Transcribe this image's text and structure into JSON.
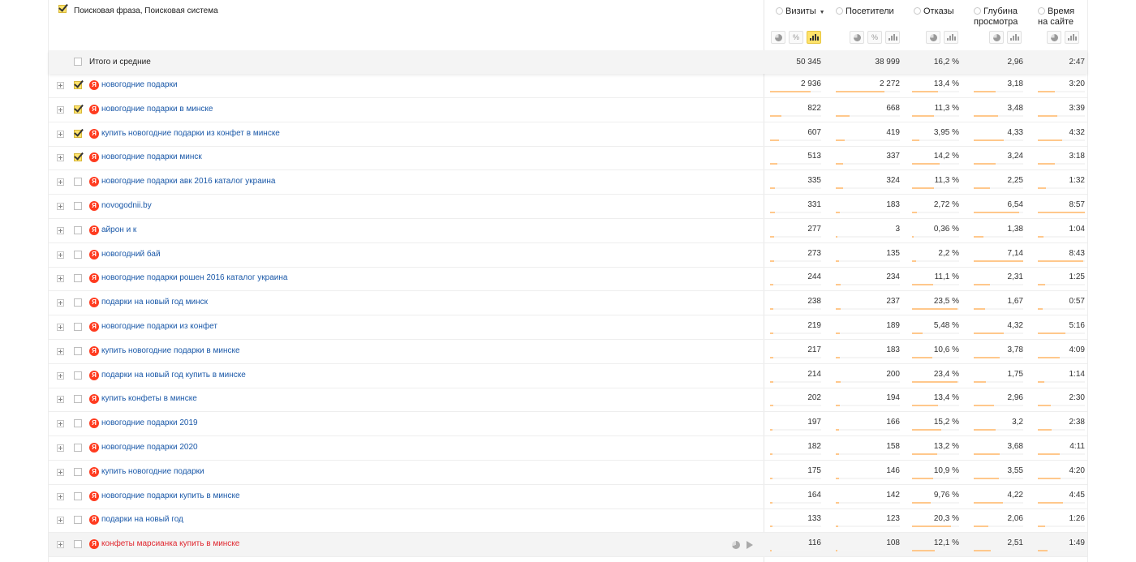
{
  "header": {
    "dimension_title": "Поисковая фраза, Поисковая система",
    "metrics": [
      {
        "key": "visits",
        "label": "Визиты",
        "sort": "▼"
      },
      {
        "key": "visitors",
        "label": "Посетители"
      },
      {
        "key": "bounce",
        "label": "Отказы"
      },
      {
        "key": "depth",
        "label": "Глубина просмотра"
      },
      {
        "key": "time",
        "label": "Время на сайте"
      }
    ]
  },
  "totals": {
    "label": "Итого и средние",
    "visits": "50 345",
    "visitors": "38 999",
    "bounce": "16,2 %",
    "depth": "2,96",
    "time": "2:47"
  },
  "rows": [
    {
      "phrase": "новогодние подарки",
      "checked": true,
      "visits": "2 936",
      "visitors": "2 272",
      "bounce": "13,4 %",
      "depth": "3,18",
      "time": "3:20"
    },
    {
      "phrase": "новогодние подарки в минске",
      "checked": true,
      "visits": "822",
      "visitors": "668",
      "bounce": "11,3 %",
      "depth": "3,48",
      "time": "3:39"
    },
    {
      "phrase": "купить новогодние подарки из конфет в минске",
      "checked": true,
      "visits": "607",
      "visitors": "419",
      "bounce": "3,95 %",
      "depth": "4,33",
      "time": "4:32"
    },
    {
      "phrase": "новогодние подарки минск",
      "checked": true,
      "visits": "513",
      "visitors": "337",
      "bounce": "14,2 %",
      "depth": "3,24",
      "time": "3:18"
    },
    {
      "phrase": "новогодние подарки авк 2016 каталог украина",
      "checked": false,
      "visits": "335",
      "visitors": "324",
      "bounce": "11,3 %",
      "depth": "2,25",
      "time": "1:32"
    },
    {
      "phrase": "novogodnii.by",
      "checked": false,
      "visits": "331",
      "visitors": "183",
      "bounce": "2,72 %",
      "depth": "6,54",
      "time": "8:57"
    },
    {
      "phrase": "айрон и к",
      "checked": false,
      "visits": "277",
      "visitors": "3",
      "bounce": "0,36 %",
      "depth": "1,38",
      "time": "1:04"
    },
    {
      "phrase": "новогодний бай",
      "checked": false,
      "visits": "273",
      "visitors": "135",
      "bounce": "2,2 %",
      "depth": "7,14",
      "time": "8:43"
    },
    {
      "phrase": "новогодние подарки рошен 2016 каталог украина",
      "checked": false,
      "visits": "244",
      "visitors": "234",
      "bounce": "11,1 %",
      "depth": "2,31",
      "time": "1:25"
    },
    {
      "phrase": "подарки на новый год минск",
      "checked": false,
      "visits": "238",
      "visitors": "237",
      "bounce": "23,5 %",
      "depth": "1,67",
      "time": "0:57"
    },
    {
      "phrase": "новогодние подарки из конфет",
      "checked": false,
      "visits": "219",
      "visitors": "189",
      "bounce": "5,48 %",
      "depth": "4,32",
      "time": "5:16"
    },
    {
      "phrase": "купить новогодние подарки в минске",
      "checked": false,
      "visits": "217",
      "visitors": "183",
      "bounce": "10,6 %",
      "depth": "3,78",
      "time": "4:09"
    },
    {
      "phrase": "подарки на новый год купить в минске",
      "checked": false,
      "visits": "214",
      "visitors": "200",
      "bounce": "23,4 %",
      "depth": "1,75",
      "time": "1:14"
    },
    {
      "phrase": "купить конфеты в минске",
      "checked": false,
      "visits": "202",
      "visitors": "194",
      "bounce": "13,4 %",
      "depth": "2,96",
      "time": "2:30"
    },
    {
      "phrase": "новогодние подарки 2019",
      "checked": false,
      "visits": "197",
      "visitors": "166",
      "bounce": "15,2 %",
      "depth": "3,2",
      "time": "2:38"
    },
    {
      "phrase": "новогодние подарки 2020",
      "checked": false,
      "visits": "182",
      "visitors": "158",
      "bounce": "13,2 %",
      "depth": "3,68",
      "time": "4:11"
    },
    {
      "phrase": "купить новогодние подарки",
      "checked": false,
      "visits": "175",
      "visitors": "146",
      "bounce": "10,9 %",
      "depth": "3,55",
      "time": "4:20"
    },
    {
      "phrase": "новогодние подарки купить в минске",
      "checked": false,
      "visits": "164",
      "visitors": "142",
      "bounce": "9,76 %",
      "depth": "4,22",
      "time": "4:45"
    },
    {
      "phrase": "подарки на новый год",
      "checked": false,
      "visits": "133",
      "visitors": "123",
      "bounce": "20,3 %",
      "depth": "2,06",
      "time": "1:26"
    },
    {
      "phrase": "конфеты марсианка купить в минске",
      "checked": false,
      "highlight": true,
      "visits": "116",
      "visitors": "108",
      "bounce": "12,1 %",
      "depth": "2,51",
      "time": "1:49"
    }
  ],
  "bar_fractions": [
    {
      "visits": 0.8,
      "visitors": 0.76,
      "bounce": 0.55,
      "depth": 0.45,
      "time": 0.37
    },
    {
      "visits": 0.23,
      "visitors": 0.22,
      "bounce": 0.46,
      "depth": 0.49,
      "time": 0.41
    },
    {
      "visits": 0.17,
      "visitors": 0.14,
      "bounce": 0.16,
      "depth": 0.61,
      "time": 0.51
    },
    {
      "visits": 0.14,
      "visitors": 0.11,
      "bounce": 0.58,
      "depth": 0.45,
      "time": 0.37
    },
    {
      "visits": 0.1,
      "visitors": 0.11,
      "bounce": 0.46,
      "depth": 0.32,
      "time": 0.17
    },
    {
      "visits": 0.09,
      "visitors": 0.06,
      "bounce": 0.11,
      "depth": 0.92,
      "time": 1.0
    },
    {
      "visits": 0.08,
      "visitors": 0.01,
      "bounce": 0.02,
      "depth": 0.19,
      "time": 0.12
    },
    {
      "visits": 0.08,
      "visitors": 0.05,
      "bounce": 0.09,
      "depth": 1.0,
      "time": 0.97
    },
    {
      "visits": 0.07,
      "visitors": 0.08,
      "bounce": 0.45,
      "depth": 0.32,
      "time": 0.16
    },
    {
      "visits": 0.07,
      "visitors": 0.08,
      "bounce": 0.96,
      "depth": 0.23,
      "time": 0.11
    },
    {
      "visits": 0.06,
      "visitors": 0.06,
      "bounce": 0.22,
      "depth": 0.61,
      "time": 0.59
    },
    {
      "visits": 0.06,
      "visitors": 0.06,
      "bounce": 0.43,
      "depth": 0.53,
      "time": 0.46
    },
    {
      "visits": 0.06,
      "visitors": 0.07,
      "bounce": 0.96,
      "depth": 0.25,
      "time": 0.14
    },
    {
      "visits": 0.06,
      "visitors": 0.06,
      "bounce": 0.55,
      "depth": 0.41,
      "time": 0.28
    },
    {
      "visits": 0.05,
      "visitors": 0.05,
      "bounce": 0.62,
      "depth": 0.45,
      "time": 0.29
    },
    {
      "visits": 0.05,
      "visitors": 0.05,
      "bounce": 0.54,
      "depth": 0.52,
      "time": 0.47
    },
    {
      "visits": 0.05,
      "visitors": 0.05,
      "bounce": 0.45,
      "depth": 0.5,
      "time": 0.48
    },
    {
      "visits": 0.05,
      "visitors": 0.05,
      "bounce": 0.4,
      "depth": 0.59,
      "time": 0.53
    },
    {
      "visits": 0.04,
      "visitors": 0.04,
      "bounce": 0.83,
      "depth": 0.29,
      "time": 0.16
    },
    {
      "visits": 0.03,
      "visitors": 0.03,
      "bounce": 0.49,
      "depth": 0.35,
      "time": 0.2
    }
  ],
  "icons": {
    "brand": "yandex-icon",
    "brand_letter": "Я"
  },
  "colors": {
    "accent": "#ffe36b",
    "link": "#1a58a8",
    "highlight_link": "#e0262e",
    "bar": "#ffc88c"
  }
}
